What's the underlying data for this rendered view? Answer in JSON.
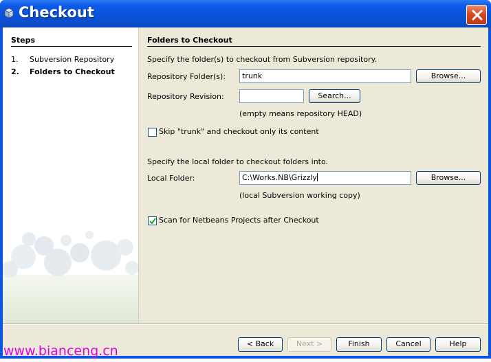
{
  "window": {
    "title": "Checkout",
    "close_label": "Close"
  },
  "steps": {
    "title": "Steps",
    "items": [
      {
        "num": "1.",
        "label": "Subversion Repository",
        "current": false
      },
      {
        "num": "2.",
        "label": "Folders to Checkout",
        "current": true
      }
    ]
  },
  "main": {
    "section_title": "Folders to Checkout",
    "repo_instruction": "Specify the folder(s) to checkout from Subversion repository.",
    "repo_folder_label": "Repository Folder(s):",
    "repo_folder_value": "trunk",
    "browse_label": "Browse...",
    "revision_label": "Repository Revision:",
    "revision_value": "",
    "search_label": "Search...",
    "revision_note": "(empty means repository HEAD)",
    "skip_label": "Skip \"trunk\" and checkout only its content",
    "skip_checked": false,
    "local_instruction": "Specify the local folder to checkout folders into.",
    "local_folder_label": "Local Folder:",
    "local_folder_value": "C:\\Works.NB\\Grizzly",
    "local_browse_label": "Browse...",
    "local_note": "(local Subversion working copy)",
    "scan_label": "Scan for Netbeans Projects after Checkout",
    "scan_checked": true
  },
  "buttons": {
    "back": "< Back",
    "next": "Next >",
    "finish": "Finish",
    "cancel": "Cancel",
    "help": "Help"
  },
  "watermark": "www.bianceng.cn",
  "colors": {
    "titlebar": "#0a52d6",
    "dialog_bg": "#ece9d8",
    "close_button": "#d9441c",
    "watermark": "#e000e0"
  }
}
